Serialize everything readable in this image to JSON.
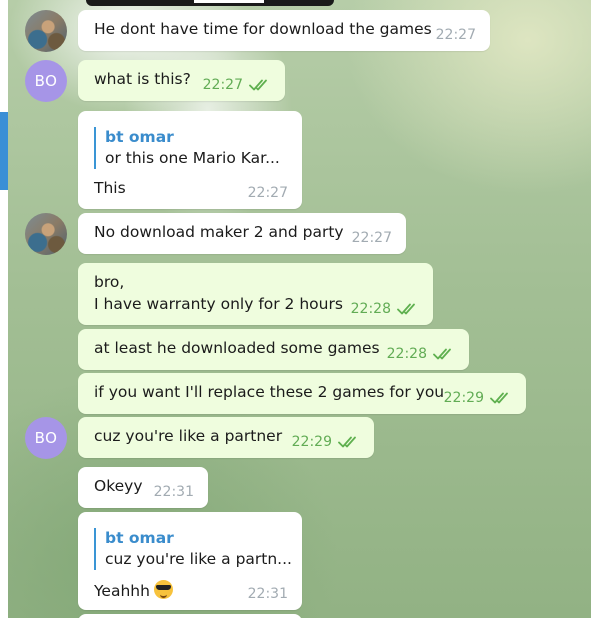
{
  "chat": {
    "avatar_initials": "BO",
    "messages": [
      {
        "type": "in",
        "text": "He dont have time for download the games",
        "time": "22:27"
      },
      {
        "type": "out",
        "text": "what is this?",
        "time": "22:27"
      },
      {
        "type": "in",
        "reply_author": "bt omar",
        "reply_text": "or this one  Mario Kar...",
        "text": "This",
        "time": "22:27"
      },
      {
        "type": "in",
        "text": "No download maker 2 and party",
        "time": "22:27"
      },
      {
        "type": "out",
        "text_line1": "bro,",
        "text_line2": "I have warranty only for 2 hours",
        "time": "22:28"
      },
      {
        "type": "out",
        "text": "at least he downloaded some games",
        "time": "22:28"
      },
      {
        "type": "out",
        "text": "if you want I'll replace these 2 games for you",
        "time": "22:29"
      },
      {
        "type": "out",
        "text": "cuz you're like a partner",
        "time": "22:29"
      },
      {
        "type": "in",
        "text": "Okeyy",
        "time": "22:31"
      },
      {
        "type": "in",
        "reply_author": "bt omar",
        "reply_text": "cuz you're like a partn...",
        "text": "Yeahhh",
        "emoji": "smiling-face-with-sunglasses",
        "time": "22:31"
      }
    ]
  }
}
